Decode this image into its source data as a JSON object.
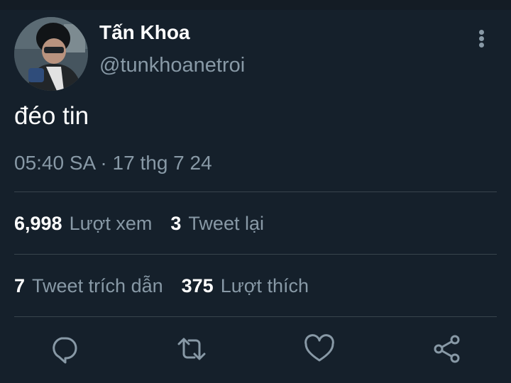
{
  "tweet": {
    "author_name": "Tấn Khoa",
    "author_handle": "@tunkhoanetroi",
    "text": "đéo tin",
    "timestamp": "05:40 SA · 17 thg 7 24"
  },
  "stats": {
    "views_count": "6,998",
    "views_label": "Lượt xem",
    "retweets_count": "3",
    "retweets_label": "Tweet lại",
    "quotes_count": "7",
    "quotes_label": "Tweet trích dẫn",
    "likes_count": "375",
    "likes_label": "Lượt thích"
  },
  "icons": {
    "menu": "more-vertical-icon",
    "reply": "reply-icon",
    "retweet": "retweet-icon",
    "like": "heart-icon",
    "share": "share-icon"
  },
  "colors": {
    "background": "#15202b",
    "secondary_text": "#8899a6",
    "divider": "#38444d"
  }
}
